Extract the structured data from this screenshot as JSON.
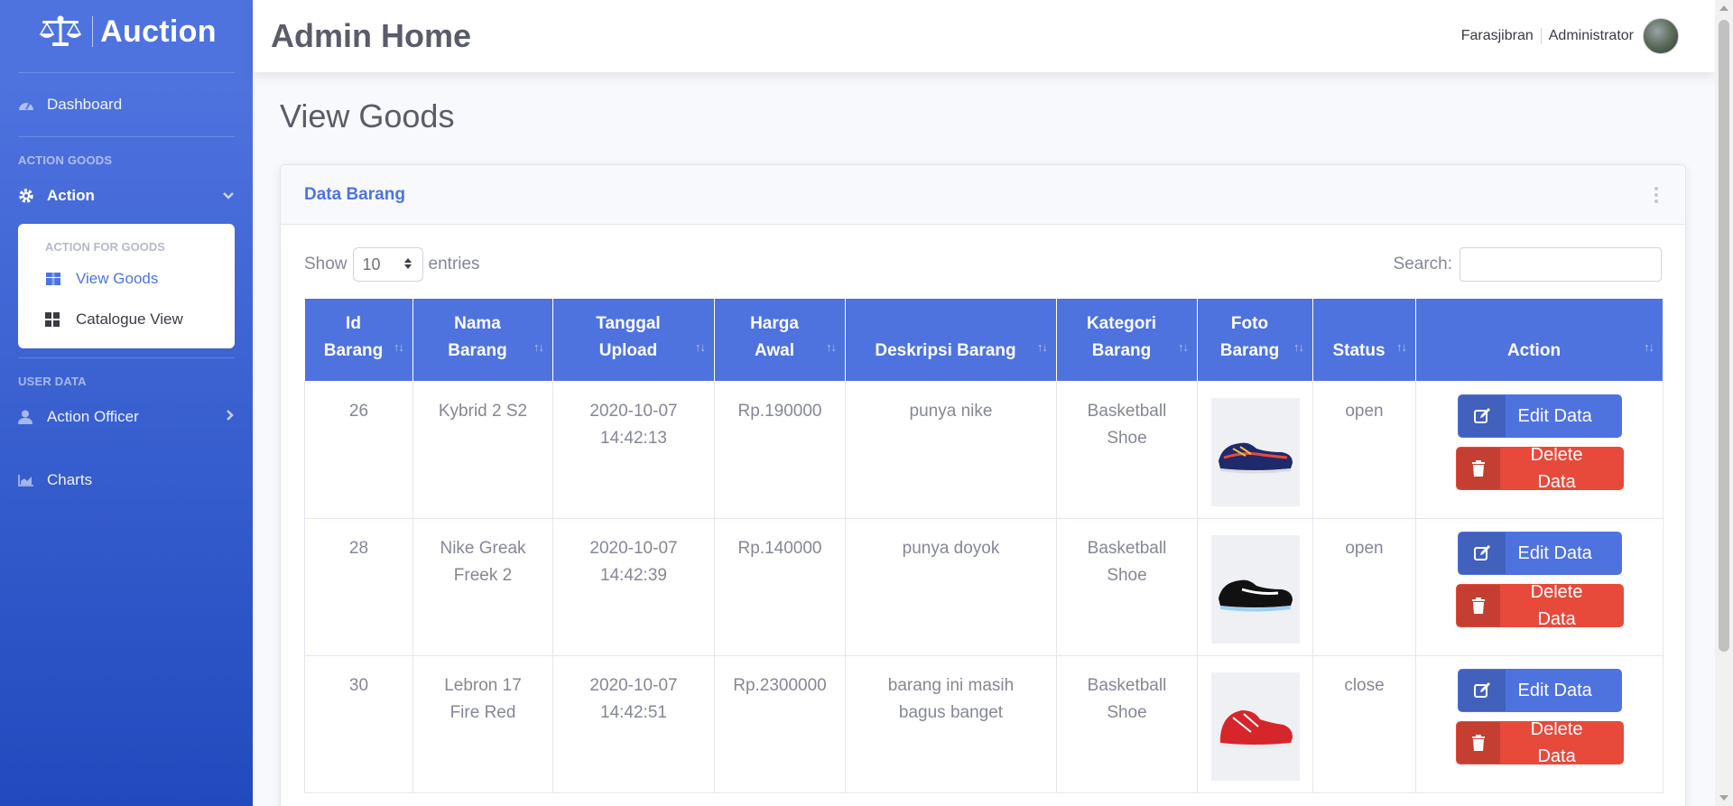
{
  "sidebar": {
    "brand": "Auction",
    "dashboard": "Dashboard",
    "heading_action": "ACTION GOODS",
    "action": "Action",
    "sub_heading": "ACTION FOR GOODS",
    "view_goods": "View Goods",
    "catalogue_view": "Catalogue View",
    "heading_user": "USER DATA",
    "action_officer": "Action Officer",
    "charts": "Charts"
  },
  "topbar": {
    "title": "Admin Home",
    "username": "Farasjibran",
    "role": "Administrator"
  },
  "page": {
    "heading": "View Goods"
  },
  "card": {
    "title": "Data Barang",
    "show_label": "Show",
    "entries_value": "10",
    "entries_label": "entries",
    "search_label": "Search:",
    "search_value": ""
  },
  "table": {
    "headers": [
      {
        "l1": "Id",
        "l2": "Barang"
      },
      {
        "l1": "Nama",
        "l2": "Barang"
      },
      {
        "l1": "Tanggal",
        "l2": "Upload"
      },
      {
        "l1": "Harga",
        "l2": "Awal"
      },
      {
        "l1": "",
        "l2": "Deskripsi Barang"
      },
      {
        "l1": "Kategori",
        "l2": "Barang"
      },
      {
        "l1": "Foto",
        "l2": "Barang"
      },
      {
        "l1": "",
        "l2": "Status"
      },
      {
        "l1": "",
        "l2": "Action"
      }
    ],
    "rows": [
      {
        "id": "26",
        "nama1": "Kybrid 2 S2",
        "nama2": "",
        "tgl1": "2020-10-07",
        "tgl2": "14:42:13",
        "harga": "Rp.190000",
        "desk1": "punya nike",
        "desk2": "",
        "kat1": "Basketball",
        "kat2": "Shoe",
        "status": "open",
        "edit": "Edit Data",
        "delete": "Delete Data"
      },
      {
        "id": "28",
        "nama1": "Nike Greak",
        "nama2": "Freek 2",
        "tgl1": "2020-10-07",
        "tgl2": "14:42:39",
        "harga": "Rp.140000",
        "desk1": "punya doyok",
        "desk2": "",
        "kat1": "Basketball",
        "kat2": "Shoe",
        "status": "open",
        "edit": "Edit Data",
        "delete": "Delete Data"
      },
      {
        "id": "30",
        "nama1": "Lebron 17",
        "nama2": "Fire Red",
        "tgl1": "2020-10-07",
        "tgl2": "14:42:51",
        "harga": "Rp.2300000",
        "desk1": "barang ini masih",
        "desk2": "bagus banget",
        "kat1": "Basketball",
        "kat2": "Shoe",
        "status": "close",
        "edit": "Edit Data",
        "delete": "Delete Data"
      }
    ]
  },
  "colors": {
    "primary": "#4e73df",
    "danger": "#e74a3b",
    "text": "#858796"
  }
}
